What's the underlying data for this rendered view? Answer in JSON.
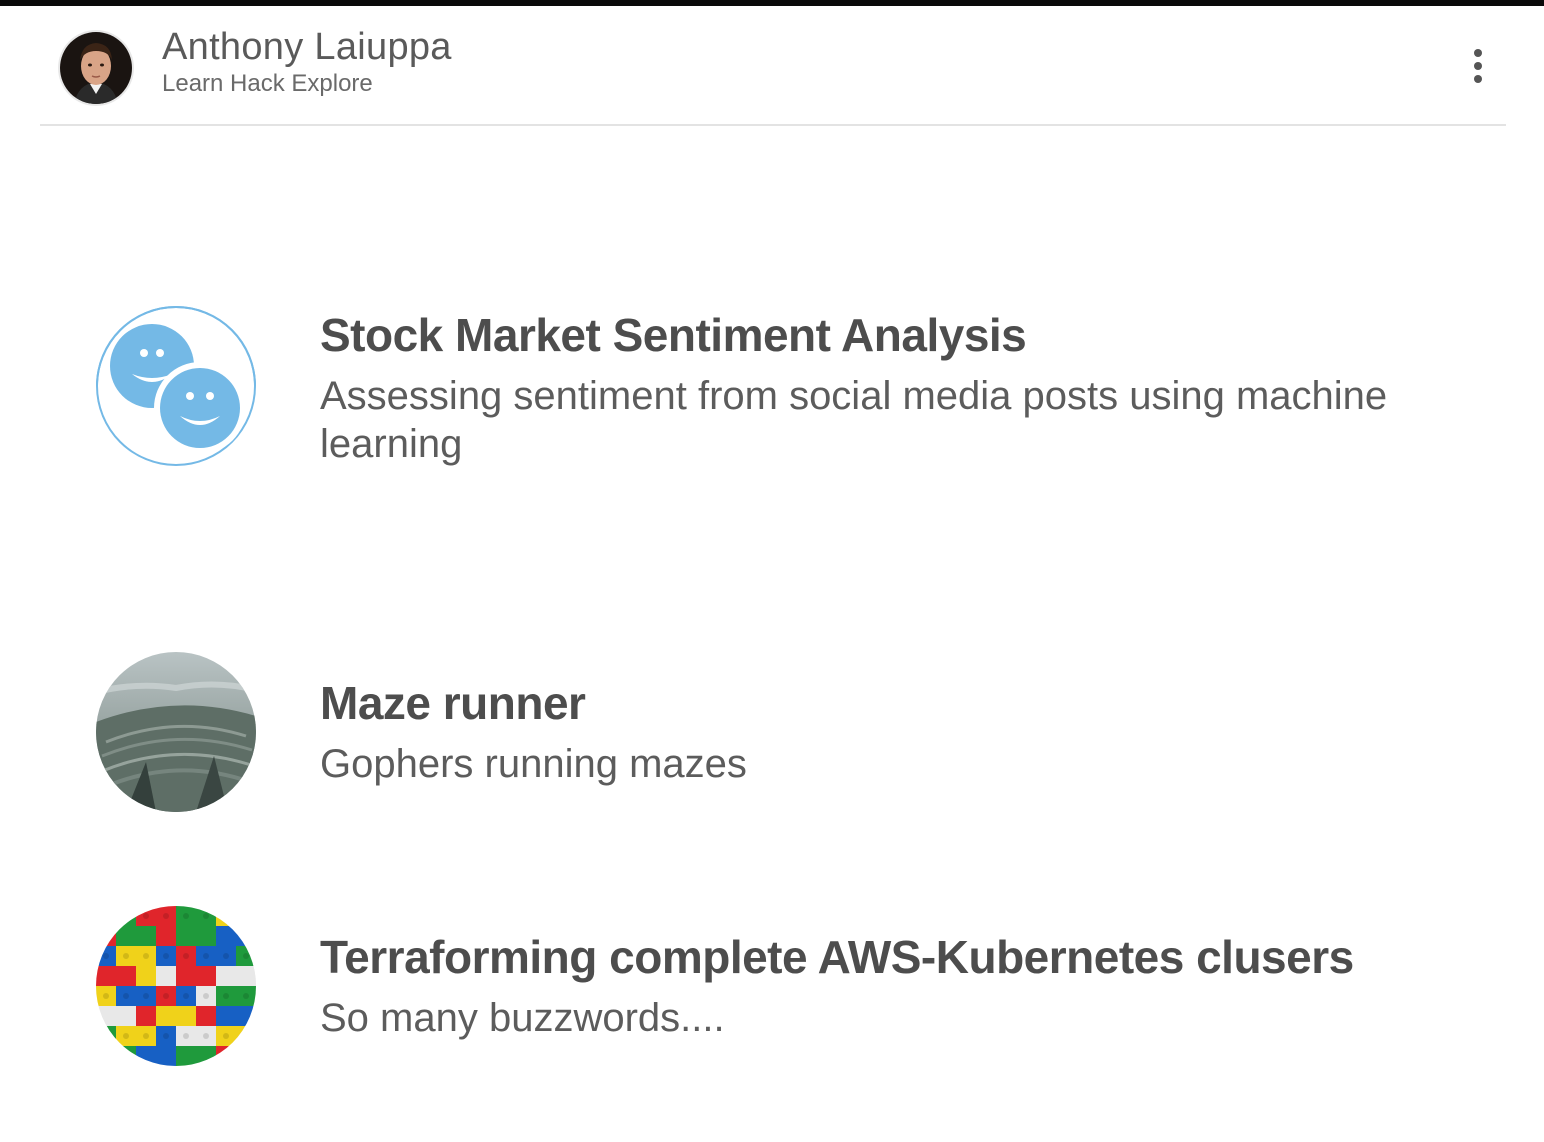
{
  "header": {
    "name": "Anthony Laiuppa",
    "tagline": "Learn Hack Explore",
    "menu_icon": "more-vert-icon"
  },
  "projects": [
    {
      "title": "Stock Market Sentiment Analysis",
      "description": "Assessing sentiment from social media posts using machine learning",
      "thumbnail": "smiley-faces-icon",
      "accent": "#74b9e6"
    },
    {
      "title": "Maze runner",
      "description": "Gophers running mazes",
      "thumbnail": "maze-photo"
    },
    {
      "title": "Terraforming complete AWS-Kubernetes clusers",
      "description": "So many buzzwords....",
      "thumbnail": "lego-bricks-photo"
    }
  ],
  "colors": {
    "text": "#555555",
    "divider": "#e3e3e3",
    "top_bar": "#0a0a0a"
  }
}
